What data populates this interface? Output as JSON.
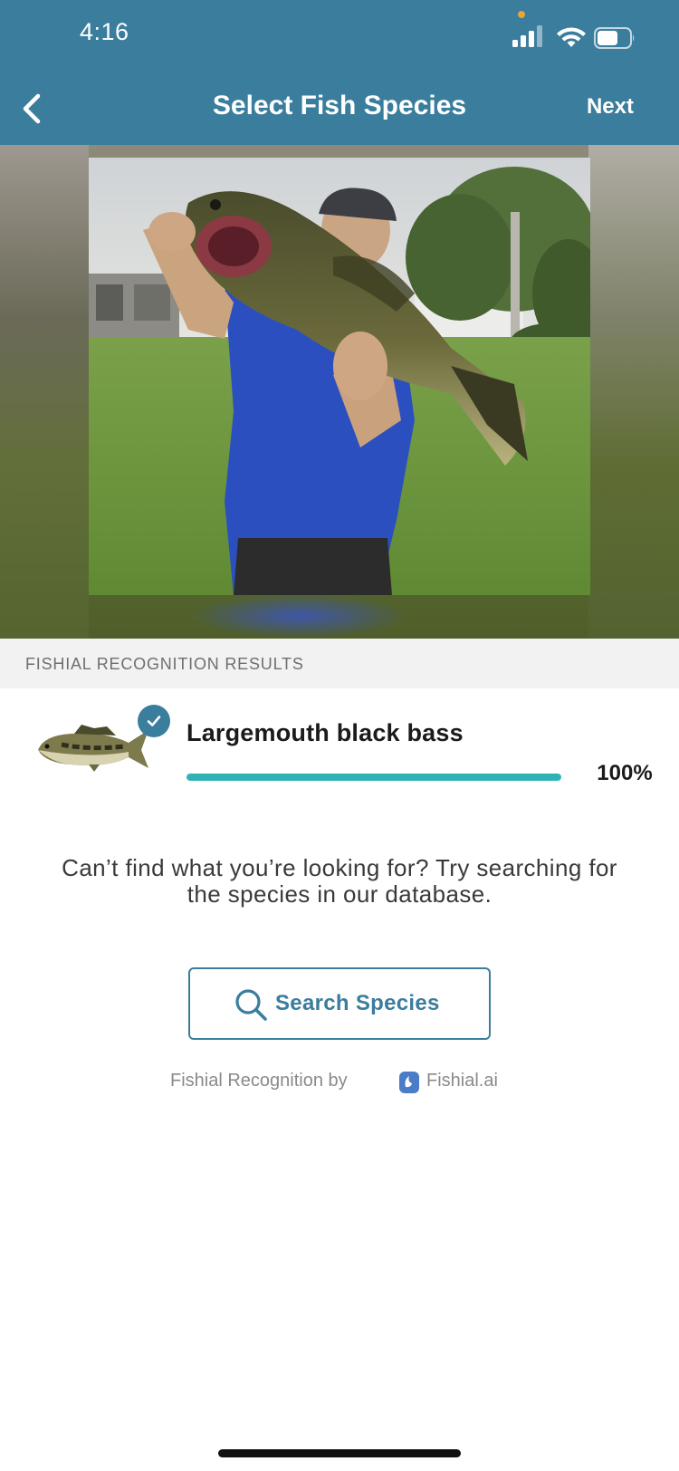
{
  "status_bar": {
    "time": "4:16"
  },
  "nav": {
    "title": "Select Fish Species",
    "next_label": "Next"
  },
  "photo": {
    "subject": "angler holding largemouth bass"
  },
  "results": {
    "section_title": "FISHIAL RECOGNITION RESULTS",
    "items": [
      {
        "name": "Largemouth black bass",
        "confidence_label": "100%",
        "confidence": 1.0,
        "selected": true
      }
    ]
  },
  "help": {
    "text": "Can’t find what you’re looking for? Try searching for the species in our database."
  },
  "search_button": {
    "label": "Search Species"
  },
  "credit": {
    "prefix": "Fishial Recognition by",
    "brand": "Fishial.ai"
  },
  "colors": {
    "header": "#3a7d9c",
    "progress": "#2fb2b6",
    "accent": "#3a7d9c"
  }
}
